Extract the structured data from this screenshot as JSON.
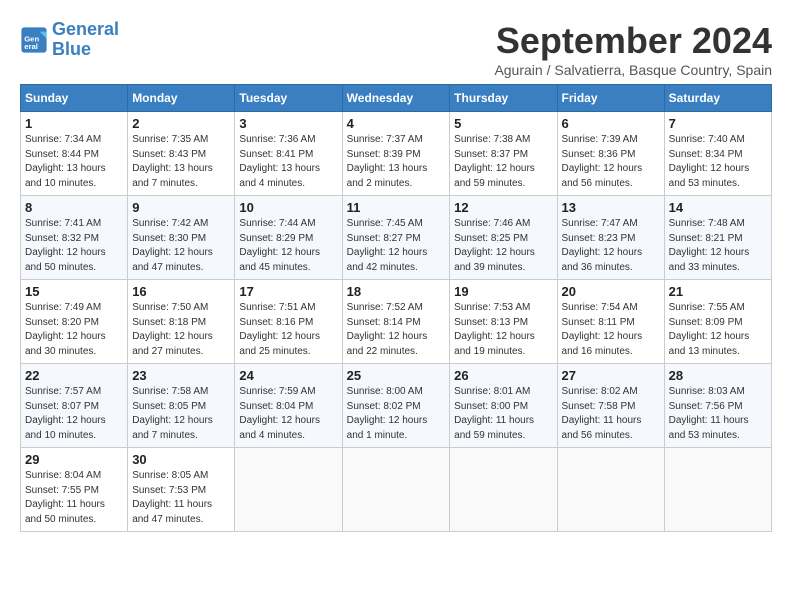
{
  "logo": {
    "line1": "General",
    "line2": "Blue"
  },
  "title": "September 2024",
  "subtitle": "Agurain / Salvatierra, Basque Country, Spain",
  "weekdays": [
    "Sunday",
    "Monday",
    "Tuesday",
    "Wednesday",
    "Thursday",
    "Friday",
    "Saturday"
  ],
  "weeks": [
    [
      {
        "day": "1",
        "info": "Sunrise: 7:34 AM\nSunset: 8:44 PM\nDaylight: 13 hours\nand 10 minutes."
      },
      {
        "day": "2",
        "info": "Sunrise: 7:35 AM\nSunset: 8:43 PM\nDaylight: 13 hours\nand 7 minutes."
      },
      {
        "day": "3",
        "info": "Sunrise: 7:36 AM\nSunset: 8:41 PM\nDaylight: 13 hours\nand 4 minutes."
      },
      {
        "day": "4",
        "info": "Sunrise: 7:37 AM\nSunset: 8:39 PM\nDaylight: 13 hours\nand 2 minutes."
      },
      {
        "day": "5",
        "info": "Sunrise: 7:38 AM\nSunset: 8:37 PM\nDaylight: 12 hours\nand 59 minutes."
      },
      {
        "day": "6",
        "info": "Sunrise: 7:39 AM\nSunset: 8:36 PM\nDaylight: 12 hours\nand 56 minutes."
      },
      {
        "day": "7",
        "info": "Sunrise: 7:40 AM\nSunset: 8:34 PM\nDaylight: 12 hours\nand 53 minutes."
      }
    ],
    [
      {
        "day": "8",
        "info": "Sunrise: 7:41 AM\nSunset: 8:32 PM\nDaylight: 12 hours\nand 50 minutes."
      },
      {
        "day": "9",
        "info": "Sunrise: 7:42 AM\nSunset: 8:30 PM\nDaylight: 12 hours\nand 47 minutes."
      },
      {
        "day": "10",
        "info": "Sunrise: 7:44 AM\nSunset: 8:29 PM\nDaylight: 12 hours\nand 45 minutes."
      },
      {
        "day": "11",
        "info": "Sunrise: 7:45 AM\nSunset: 8:27 PM\nDaylight: 12 hours\nand 42 minutes."
      },
      {
        "day": "12",
        "info": "Sunrise: 7:46 AM\nSunset: 8:25 PM\nDaylight: 12 hours\nand 39 minutes."
      },
      {
        "day": "13",
        "info": "Sunrise: 7:47 AM\nSunset: 8:23 PM\nDaylight: 12 hours\nand 36 minutes."
      },
      {
        "day": "14",
        "info": "Sunrise: 7:48 AM\nSunset: 8:21 PM\nDaylight: 12 hours\nand 33 minutes."
      }
    ],
    [
      {
        "day": "15",
        "info": "Sunrise: 7:49 AM\nSunset: 8:20 PM\nDaylight: 12 hours\nand 30 minutes."
      },
      {
        "day": "16",
        "info": "Sunrise: 7:50 AM\nSunset: 8:18 PM\nDaylight: 12 hours\nand 27 minutes."
      },
      {
        "day": "17",
        "info": "Sunrise: 7:51 AM\nSunset: 8:16 PM\nDaylight: 12 hours\nand 25 minutes."
      },
      {
        "day": "18",
        "info": "Sunrise: 7:52 AM\nSunset: 8:14 PM\nDaylight: 12 hours\nand 22 minutes."
      },
      {
        "day": "19",
        "info": "Sunrise: 7:53 AM\nSunset: 8:13 PM\nDaylight: 12 hours\nand 19 minutes."
      },
      {
        "day": "20",
        "info": "Sunrise: 7:54 AM\nSunset: 8:11 PM\nDaylight: 12 hours\nand 16 minutes."
      },
      {
        "day": "21",
        "info": "Sunrise: 7:55 AM\nSunset: 8:09 PM\nDaylight: 12 hours\nand 13 minutes."
      }
    ],
    [
      {
        "day": "22",
        "info": "Sunrise: 7:57 AM\nSunset: 8:07 PM\nDaylight: 12 hours\nand 10 minutes."
      },
      {
        "day": "23",
        "info": "Sunrise: 7:58 AM\nSunset: 8:05 PM\nDaylight: 12 hours\nand 7 minutes."
      },
      {
        "day": "24",
        "info": "Sunrise: 7:59 AM\nSunset: 8:04 PM\nDaylight: 12 hours\nand 4 minutes."
      },
      {
        "day": "25",
        "info": "Sunrise: 8:00 AM\nSunset: 8:02 PM\nDaylight: 12 hours\nand 1 minute."
      },
      {
        "day": "26",
        "info": "Sunrise: 8:01 AM\nSunset: 8:00 PM\nDaylight: 11 hours\nand 59 minutes."
      },
      {
        "day": "27",
        "info": "Sunrise: 8:02 AM\nSunset: 7:58 PM\nDaylight: 11 hours\nand 56 minutes."
      },
      {
        "day": "28",
        "info": "Sunrise: 8:03 AM\nSunset: 7:56 PM\nDaylight: 11 hours\nand 53 minutes."
      }
    ],
    [
      {
        "day": "29",
        "info": "Sunrise: 8:04 AM\nSunset: 7:55 PM\nDaylight: 11 hours\nand 50 minutes."
      },
      {
        "day": "30",
        "info": "Sunrise: 8:05 AM\nSunset: 7:53 PM\nDaylight: 11 hours\nand 47 minutes."
      },
      {
        "day": "",
        "info": ""
      },
      {
        "day": "",
        "info": ""
      },
      {
        "day": "",
        "info": ""
      },
      {
        "day": "",
        "info": ""
      },
      {
        "day": "",
        "info": ""
      }
    ]
  ]
}
